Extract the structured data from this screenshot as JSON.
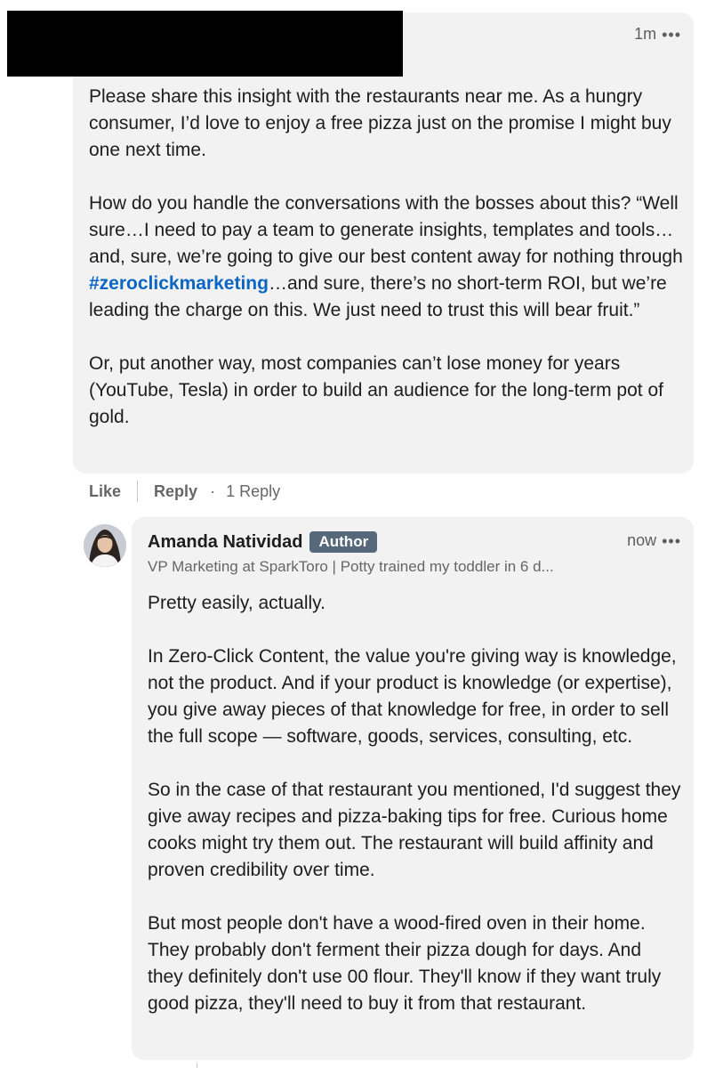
{
  "comment": {
    "timestamp": "1m",
    "more_glyph": "•••",
    "paragraph_1": "Please share this insight with the restaurants near me. As a hungry consumer, I’d love to enjoy a free pizza just on the promise I might buy one next time.",
    "paragraph_2_before": "How do you handle the conversations with the bosses about this? “Well sure…I need to pay a team to generate insights, templates and tools…and, sure, we’re going to give our best content away for nothing through ",
    "hashtag": "#zeroclickmarketing",
    "paragraph_2_after": "…and sure, there’s no short-term ROI, but we’re leading the charge on this. We just need to trust this will bear fruit.”",
    "paragraph_3": "Or, put another way, most companies can’t lose money for years (YouTube, Tesla) in order to build an audience for the long-term pot of gold.",
    "hashtag_color": "#0a66c2"
  },
  "actions": {
    "like": "Like",
    "reply": "Reply",
    "separator": "·",
    "reply_count": "1 Reply"
  },
  "reply": {
    "author_name": "Amanda Natividad",
    "badge": "Author",
    "timestamp": "now",
    "more_glyph": "•••",
    "headline": "VP Marketing at SparkToro | Potty trained my toddler in 6 d...",
    "paragraphs": [
      "Pretty easily, actually.",
      "In Zero-Click Content, the value you're giving way is knowledge, not the product. And if your product is knowledge (or expertise), you give away pieces of that knowledge for free, in order to sell the full scope — software, goods, services, consulting, etc.",
      "So in the case of that restaurant you mentioned, I'd suggest they give away recipes and pizza-baking tips for free. Curious home cooks might try them out. The restaurant will build affinity and proven credibility over time.",
      "But most people don't have a wood-fired oven in their home. They probably don't ferment their pizza dough for days. And they definitely don't use 00 flour. They'll know if they want truly good pizza, they'll need to buy it from that restaurant."
    ],
    "badge_color": "#56687a"
  }
}
